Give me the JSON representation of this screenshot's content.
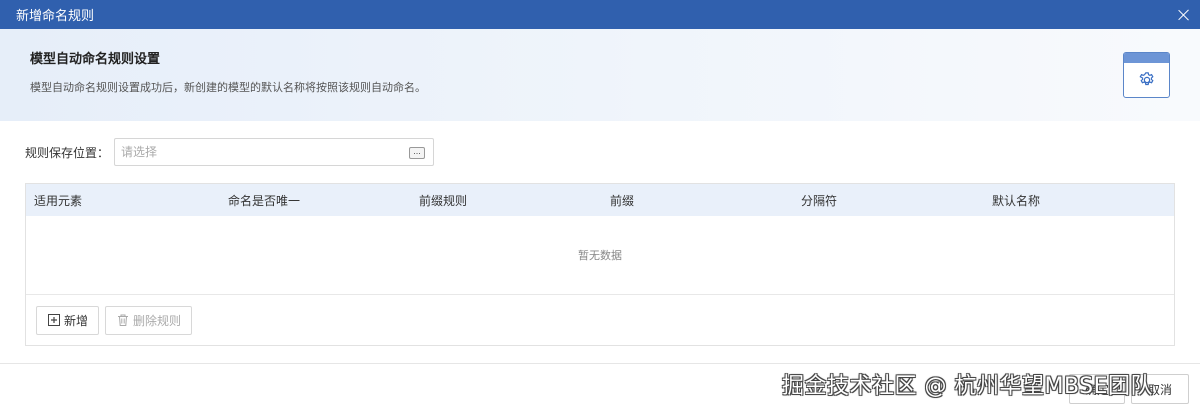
{
  "window": {
    "title": "新增命名规则"
  },
  "banner": {
    "heading": "模型自动命名规则设置",
    "description": "模型自动命名规则设置成功后，新创建的模型的默认名称将按照该规则自动命名。",
    "icon": "settings-gear-icon"
  },
  "location": {
    "label": "规则保存位置：",
    "placeholder": "请选择",
    "value": "",
    "browse_label": "..."
  },
  "table": {
    "columns": [
      "适用元素",
      "命名是否唯一",
      "前缀规则",
      "前缀",
      "分隔符",
      "默认名称"
    ],
    "rows": [],
    "empty_text": "暂无数据"
  },
  "toolbar": {
    "add_label": "新增",
    "delete_label": "删除规则"
  },
  "footer": {
    "ok_label": "确定",
    "cancel_label": "取消"
  },
  "watermark": "掘金技术社区 @ 杭州华望MBSE团队",
  "colors": {
    "titlebar": "#3060ae",
    "table_header": "#e9f0fa",
    "icon_accent": "#6d95d6"
  }
}
